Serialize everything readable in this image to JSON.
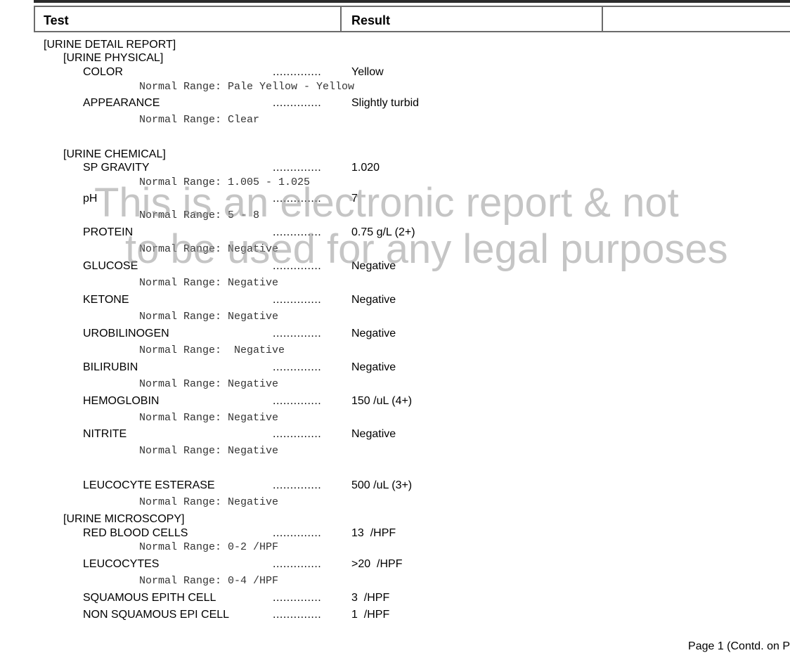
{
  "table_header": {
    "test": "Test",
    "result": "Result",
    "extra": ""
  },
  "report": {
    "title": "[URINE DETAIL REPORT]",
    "physical": "[URINE PHYSICAL]",
    "chemical": "[URINE CHEMICAL]",
    "microscopy": "[URINE MICROSCOPY]"
  },
  "dots": "..............",
  "tests": [
    {
      "name": "COLOR",
      "result": "Yellow",
      "range": "Normal Range: Pale Yellow - Yellow"
    },
    {
      "name": "APPEARANCE",
      "result": "Slightly turbid",
      "range": "Normal Range: Clear"
    },
    {
      "name": "SP GRAVITY",
      "result": "1.020",
      "range": "Normal Range: 1.005 - 1.025"
    },
    {
      "name": "pH",
      "result": "7",
      "range": "Normal Range: 5 - 8"
    },
    {
      "name": "PROTEIN",
      "result": "0.75 g/L (2+)",
      "range": "Normal Range: Negative"
    },
    {
      "name": "GLUCOSE",
      "result": "Negative",
      "range": "Normal Range: Negative"
    },
    {
      "name": "KETONE",
      "result": "Negative",
      "range": "Normal Range: Negative"
    },
    {
      "name": "UROBILINOGEN",
      "result": "Negative",
      "range": "Normal Range:  Negative"
    },
    {
      "name": "BILIRUBIN",
      "result": "Negative",
      "range": "Normal Range: Negative"
    },
    {
      "name": "HEMOGLOBIN",
      "result": "150 /uL (4+)",
      "range": "Normal Range: Negative"
    },
    {
      "name": "NITRITE",
      "result": "Negative",
      "range": "Normal Range: Negative"
    },
    {
      "name": "LEUCOCYTE ESTERASE",
      "result": "500 /uL (3+)",
      "range": "Normal Range: Negative"
    },
    {
      "name": "RED BLOOD CELLS",
      "result": "13  /HPF",
      "range": "Normal Range: 0-2 /HPF"
    },
    {
      "name": "LEUCOCYTES",
      "result": ">20  /HPF",
      "range": "Normal Range: 0-4 /HPF"
    },
    {
      "name": "SQUAMOUS EPITH CELL",
      "result": "3  /HPF"
    },
    {
      "name": "NON SQUAMOUS EPI CELL",
      "result": "1  /HPF"
    }
  ],
  "watermark": {
    "line1": "This is an electronic report & not",
    "line2": "to be used for any legal purposes"
  },
  "footer": {
    "page": "Page 1 (Contd. on P"
  }
}
